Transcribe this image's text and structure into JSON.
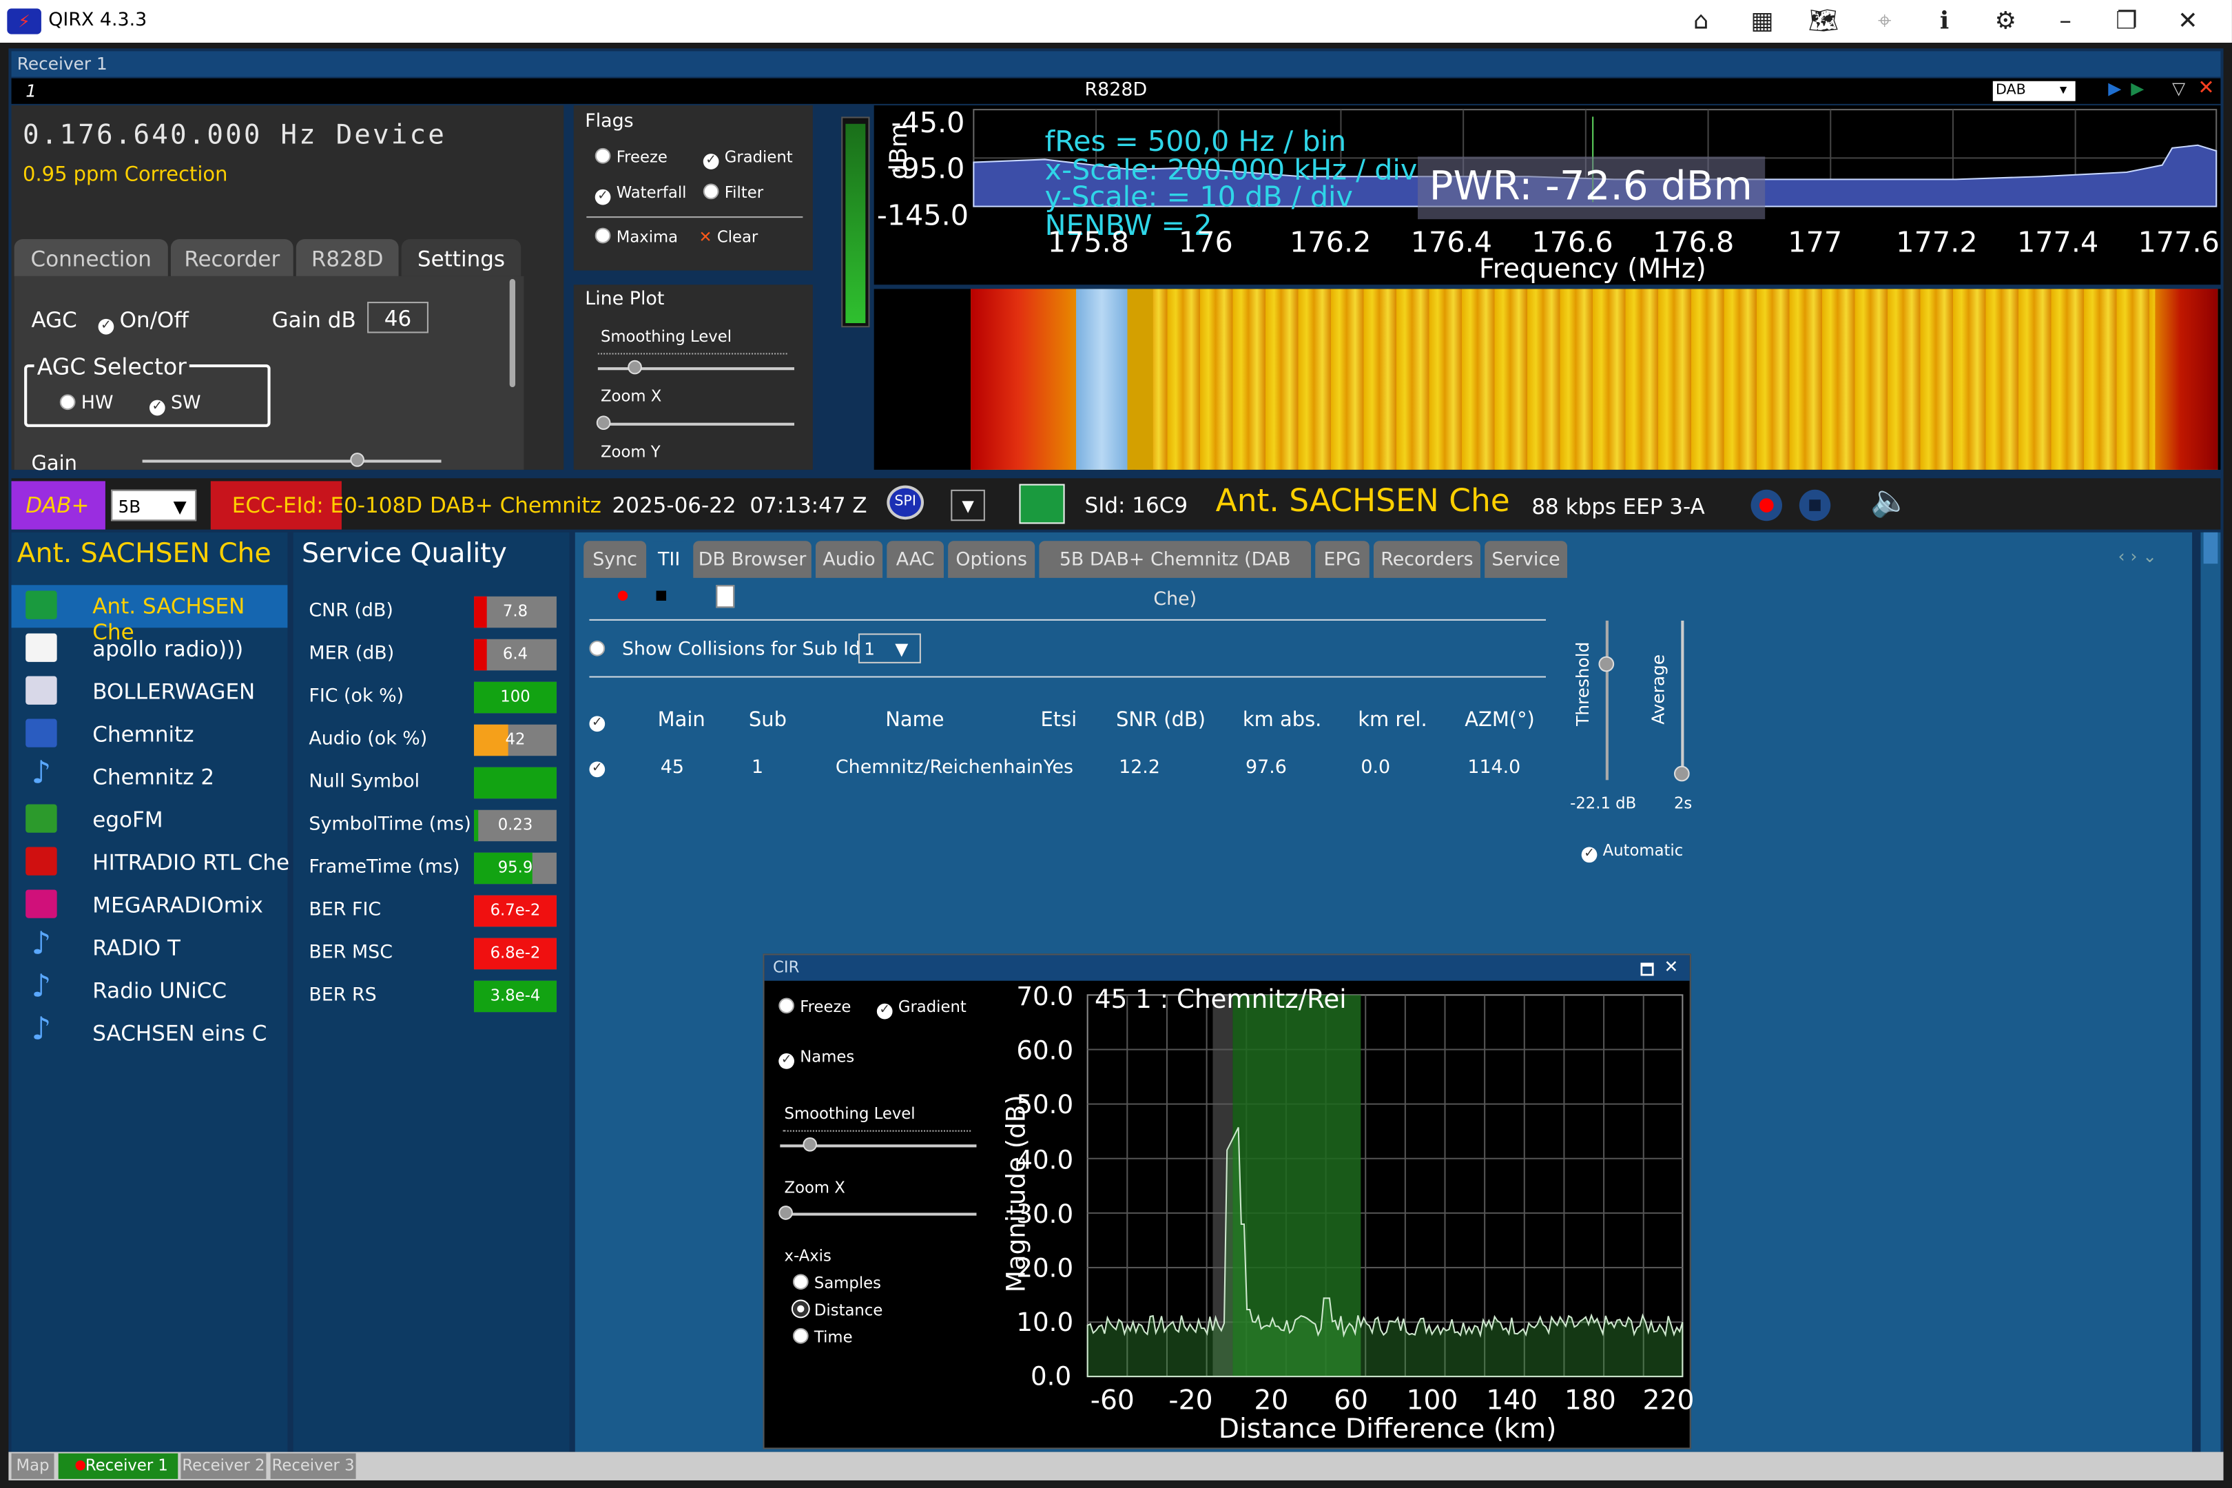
{
  "app": {
    "title": "QIRX 4.3.3"
  },
  "receiver": {
    "header": "Receiver 1",
    "index": "1",
    "device_name": "R828D"
  },
  "control": {
    "frequency": "0.176.640.000 Hz Device",
    "ppm": "0.95 ppm Correction",
    "tabs": [
      "Connection",
      "Recorder",
      "R828D",
      "Settings"
    ],
    "agc_label": "AGC",
    "agc_toggle": "On/Off",
    "gain_label": "Gain dB",
    "gain_value": "46",
    "agc_selector": "AGC Selector",
    "hw": "HW",
    "sw": "SW",
    "gain_row": "Gain"
  },
  "flags": {
    "title": "Flags",
    "freeze": "Freeze",
    "gradient": "Gradient",
    "waterfall": "Waterfall",
    "filter": "Filter",
    "maxima": "Maxima",
    "clear": "Clear"
  },
  "lineplot": {
    "title": "Line Plot",
    "smoothing": "Smoothing Level",
    "zoomx": "Zoom X",
    "zoomy": "Zoom Y"
  },
  "spectrum": {
    "mode": "DAB",
    "ytop": "-45.0",
    "ymid": "-95.0",
    "ybot": "-145.0",
    "ylabel": "dBm",
    "fres": "fRes = 500,0 Hz / bin",
    "xscale": "x-Scale: 200.000 kHz / div",
    "yscale": "y-Scale: = 10 dB / div",
    "nenbw": "NENBW = 2",
    "pwr": "PWR: -72.6 dBm",
    "xticks": [
      "175.8",
      "176",
      "176.2",
      "176.4",
      "176.6",
      "176.8",
      "177",
      "177.2",
      "177.4",
      "177.6"
    ],
    "xlabel": "Frequency (MHz)"
  },
  "status": {
    "mode": "DAB+",
    "channel": "5B",
    "ecc": "ECC-EId: E0-108D",
    "ensemble": "DAB+ Chemnitz",
    "datetime": "2025-06-22  07:13:47 Z",
    "spi": "SPI",
    "sid": "SId: 16C9",
    "service": "Ant. SACHSEN Che",
    "bitrate": "88 kbps",
    "eep": "EEP 3-A"
  },
  "services": {
    "header": "Ant. SACHSEN Che",
    "items": [
      {
        "label": "Ant. SACHSEN Che",
        "selected": true,
        "icon": "antenne-sachsen-logo"
      },
      {
        "label": "apollo radio)))",
        "icon": "apollo-logo"
      },
      {
        "label": "BOLLERWAGEN",
        "icon": "bollerwagen-logo"
      },
      {
        "label": "Chemnitz",
        "icon": "radio-chemnitz-logo"
      },
      {
        "label": "Chemnitz 2",
        "icon": "music-note-icon"
      },
      {
        "label": "egoFM",
        "icon": "egofm-logo"
      },
      {
        "label": "HITRADIO RTL Che",
        "icon": "rtl-logo"
      },
      {
        "label": "MEGARADIOmix",
        "icon": "mega-logo"
      },
      {
        "label": "RADIO T",
        "icon": "music-note-icon"
      },
      {
        "label": "Radio UNiCC",
        "icon": "music-note-icon"
      },
      {
        "label": "SACHSEN eins C",
        "icon": "music-note-icon"
      }
    ]
  },
  "quality": {
    "header": "Service Quality",
    "rows": [
      {
        "label": "CNR (dB)",
        "value": "7.8",
        "fill": 0.15,
        "color": "#e00000"
      },
      {
        "label": "MER (dB)",
        "value": "6.4",
        "fill": 0.15,
        "color": "#e00000"
      },
      {
        "label": "FIC (ok %)",
        "value": "100",
        "fill": 1.0,
        "color": "#12a312"
      },
      {
        "label": "Audio (ok %)",
        "value": "42",
        "fill": 0.42,
        "color": "#f5a01a"
      },
      {
        "label": "Null Symbol",
        "value": "",
        "fill": 1.0,
        "color": "#12a312"
      },
      {
        "label": "SymbolTime (ms)",
        "value": "0.23",
        "fill": 0.06,
        "color": "#12a312"
      },
      {
        "label": "FrameTime (ms)",
        "value": "95.9",
        "fill": 0.7,
        "color": "#12a312"
      },
      {
        "label": "BER FIC",
        "value": "6.7e-2",
        "fill": 1.0,
        "color": "#f01010"
      },
      {
        "label": "BER MSC",
        "value": "6.8e-2",
        "fill": 1.0,
        "color": "#f01010"
      },
      {
        "label": "BER RS",
        "value": "3.8e-4",
        "fill": 1.0,
        "color": "#12a312"
      }
    ]
  },
  "tabs": [
    "Sync",
    "TII",
    "DB Browser",
    "Audio",
    "AAC",
    "Options",
    "5B DAB+ Chemnitz (DAB Che)",
    "EPG",
    "Recorders",
    "Service"
  ],
  "tii": {
    "show_collisions": "Show Collisions for Sub Id",
    "sub_id": "1",
    "columns": [
      "Main",
      "Sub",
      "Name",
      "Etsi",
      "SNR (dB)",
      "km abs.",
      "km rel.",
      "AZM(°)"
    ],
    "rows": [
      [
        "45",
        "1",
        "Chemnitz/Reichenhain",
        "Yes",
        "12.2",
        "97.6",
        "0.0",
        "114.0"
      ]
    ],
    "threshold_label": "Threshold",
    "average_label": "Average",
    "threshold_value": "-22.1 dB",
    "average_value": "2s",
    "automatic": "Automatic"
  },
  "cir": {
    "title": "CIR",
    "freeze": "Freeze",
    "gradient": "Gradient",
    "names": "Names",
    "smoothing": "Smoothing Level",
    "zoomx": "Zoom X",
    "xaxis": "x-Axis",
    "samples": "Samples",
    "distance": "Distance",
    "time": "Time",
    "plot_title": "45 1 : Chemnitz/Rei",
    "ylabel": "Magnitude (dB)",
    "xlabel": "Distance Difference (km)",
    "yticks": [
      "70.0",
      "60.0",
      "50.0",
      "40.0",
      "30.0",
      "20.0",
      "10.0",
      "0.0"
    ],
    "xticks": [
      "-60",
      "-20",
      "20",
      "60",
      "100",
      "140",
      "180",
      "220"
    ]
  },
  "bottom_tabs": [
    "Map",
    "Receiver 1",
    "Receiver 2",
    "Receiver 3"
  ]
}
